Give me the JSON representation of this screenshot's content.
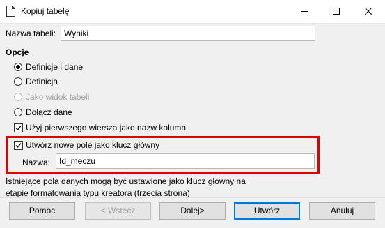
{
  "window": {
    "title": "Kopiuj tabelę",
    "minimize_icon": "minimize-icon",
    "maximize_icon": "maximize-icon",
    "close_icon": "close-icon"
  },
  "table_name": {
    "label": "Nazwa tabeli:",
    "value": "Wyniki"
  },
  "options": {
    "heading": "Opcje",
    "radios": [
      {
        "label": "Definicje i dane",
        "checked": true,
        "enabled": true
      },
      {
        "label": "Definicja",
        "checked": false,
        "enabled": true
      },
      {
        "label": "Jako widok tabeli",
        "checked": false,
        "enabled": false
      },
      {
        "label": "Dołącz dane",
        "checked": false,
        "enabled": true
      }
    ],
    "use_first_row": {
      "label": "Użyj pierwszego wiersza jako nazw kolumn",
      "checked": true
    },
    "create_primary_key": {
      "label": "Utwórz nowe pole jako klucz główny",
      "checked": true
    },
    "key_name": {
      "label": "Nazwa:",
      "value": "Id_meczu"
    }
  },
  "info_text": "Istniejące pola danych mogą być ustawione jako klucz główny na etapie formatowania typu kreatora (trzecia strona)",
  "buttons": {
    "help": "Pomoc",
    "back": "< Wstecz",
    "next": "Dalej>",
    "create": "Utwórz",
    "cancel": "Anuluj"
  },
  "colors": {
    "highlight": "#e00000",
    "default_button_border": "#0078d7"
  }
}
